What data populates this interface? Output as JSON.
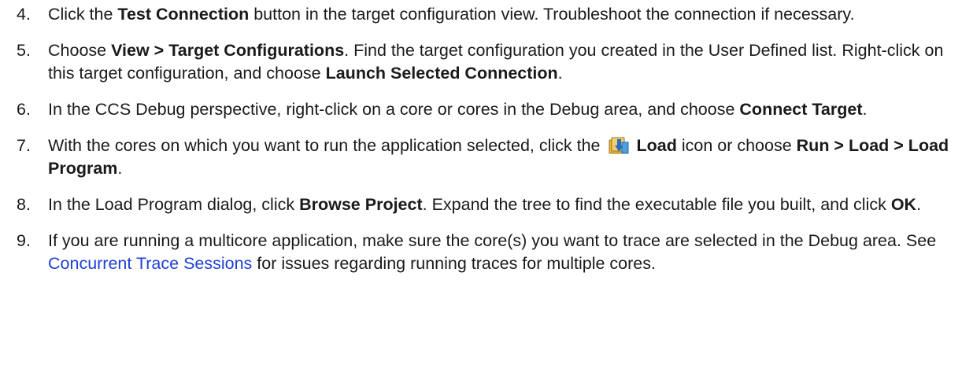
{
  "steps": [
    {
      "num": "4.",
      "pre": "Click the ",
      "b1": "Test Connection",
      "post": " button in the target configuration view. Troubleshoot the connection if necessary."
    },
    {
      "num": "5.",
      "pre": "Choose ",
      "b1": "View > Target Configurations",
      "mid": ". Find the target configuration you created in the User Defined list. Right-click on this target configuration, and choose ",
      "b2": "Launch Selected Connection",
      "post": "."
    },
    {
      "num": "6.",
      "pre": "In the CCS Debug perspective, right-click on a core or cores in the Debug area, and choose ",
      "b1": "Connect Target",
      "post": "."
    },
    {
      "num": "7.",
      "pre": "With the cores on which you want to run the application selected, click the",
      "icon": "load-icon",
      "b1": "Load",
      "mid": " icon or choose ",
      "b2": "Run > Load > Load Program",
      "post": "."
    },
    {
      "num": "8.",
      "pre": "In the Load Program dialog, click ",
      "b1": "Browse Project",
      "mid": ". Expand the tree to find the executable file you built, and click ",
      "b2": "OK",
      "post": "."
    },
    {
      "num": "9.",
      "pre": "If you are running a multicore application, make sure the core(s) you want to trace are selected in the Debug area. See ",
      "link": "Concurrent Trace Sessions",
      "post": " for issues regarding running traces for multiple cores."
    }
  ],
  "colors": {
    "text": "#1a1a1a",
    "link": "#1f3fd8",
    "icon_fill": "#e8b43a",
    "icon_arrow": "#2b6cc4"
  }
}
